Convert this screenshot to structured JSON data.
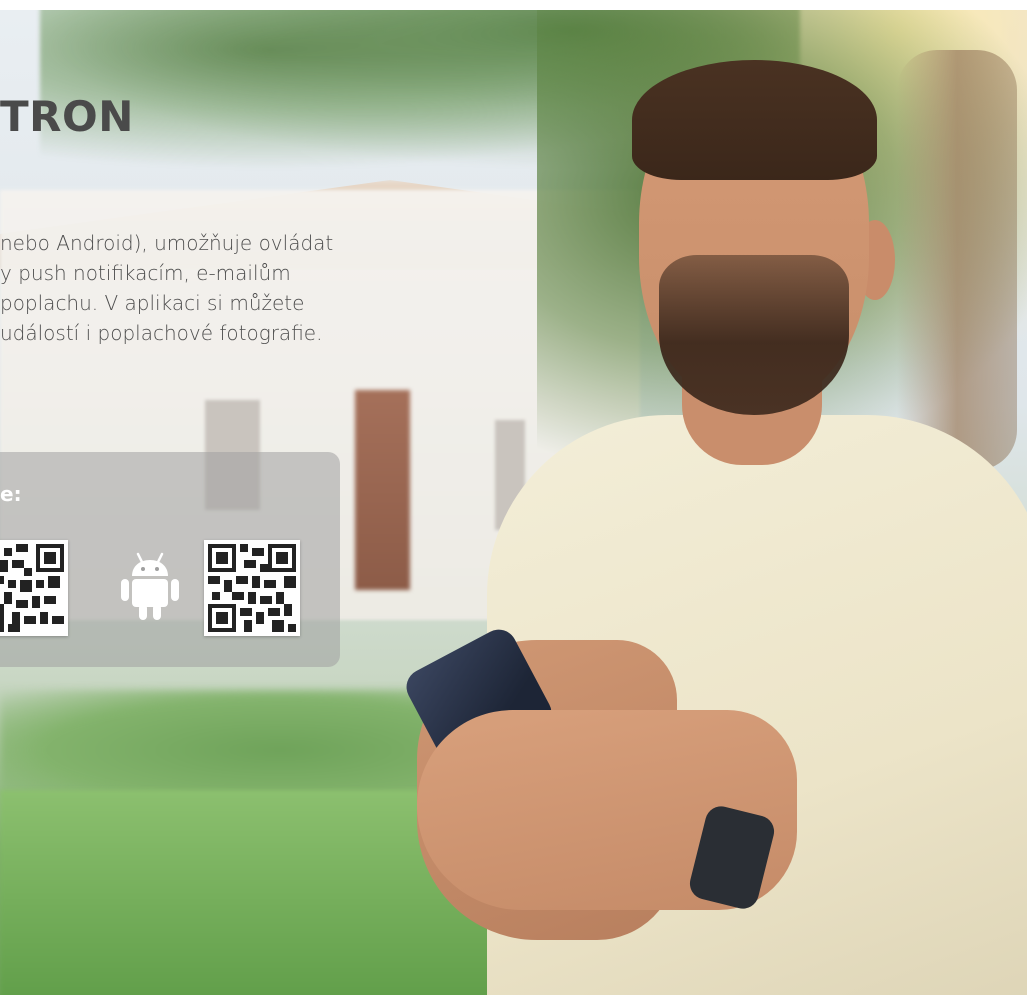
{
  "hero": {
    "title": "TRON",
    "description_lines": [
      "nebo Android), umožňuje ovládat",
      "y push notifikacím, e-mailům",
      "poplachu. V aplikaci si můžete",
      "událostí i poplachové fotografie."
    ]
  },
  "download": {
    "heading": "e:",
    "icons": [
      "qr-code-icon",
      "android-icon",
      "qr-code-icon"
    ]
  },
  "colors": {
    "title": "#4a4a4a",
    "text": "#4d4d4d",
    "panel": "#a0a0a0",
    "panel_text": "#ffffff"
  }
}
